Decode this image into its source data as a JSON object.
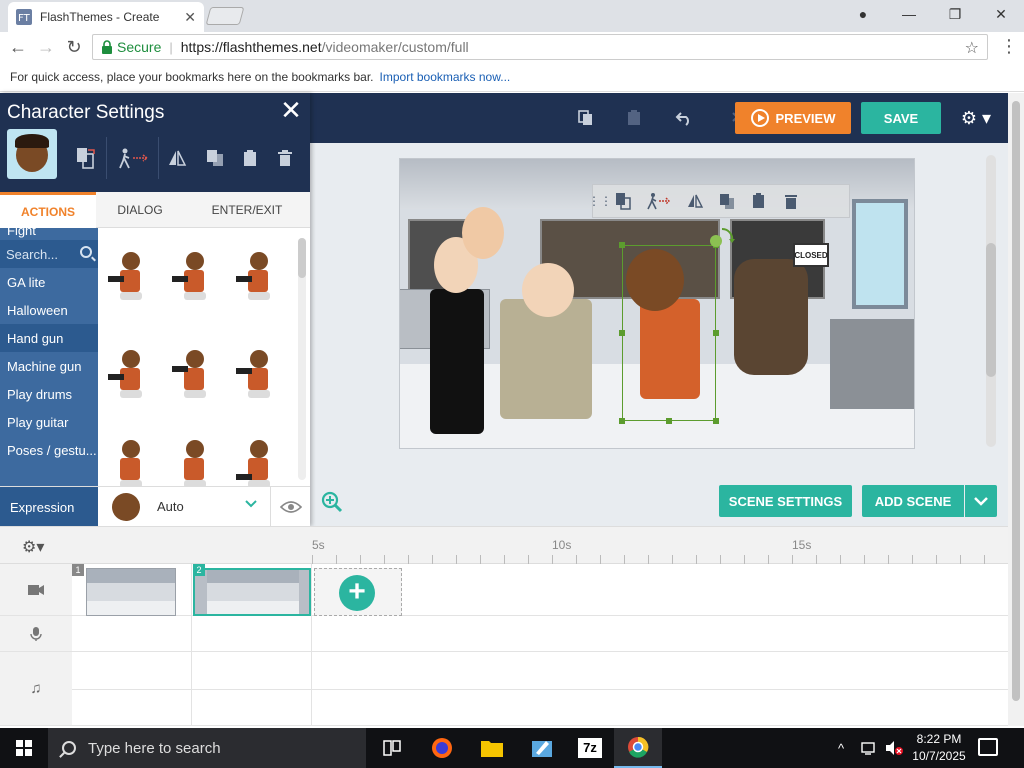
{
  "browser": {
    "tab_title": "FlashThemes - Create",
    "tab_close": "✕",
    "window_controls": {
      "account": "●",
      "minimize": "—",
      "restore": "❐",
      "close": "✕"
    },
    "nav": {
      "back": "←",
      "forward": "→",
      "reload": "↻"
    },
    "address": {
      "secure_label": "Secure",
      "host": "https://flashthemes.net",
      "path": "/videomaker/custom/full"
    },
    "bookmark_icon": "☆",
    "menu_icon": "⋮",
    "bookmarks_bar": {
      "message": "For quick access, place your bookmarks here on the bookmarks bar.",
      "link": "Import bookmarks now..."
    }
  },
  "topbar": {
    "icons": [
      "copy-icon",
      "paste-icon",
      "undo-icon",
      "redo-icon"
    ],
    "preview_label": "PREVIEW",
    "save_label": "SAVE",
    "settings_icon": "⚙ ▾",
    "accent_orange": "#f0822b",
    "accent_teal": "#2bb5a0",
    "nav_bg": "#1f3152"
  },
  "character_panel": {
    "title": "Character Settings",
    "close": "✕",
    "tool_icons": [
      "swap-character-icon",
      "walk-motion-icon",
      "flip-icon",
      "copy-icon",
      "paste-icon",
      "delete-icon"
    ],
    "tabs": [
      {
        "label": "ACTIONS",
        "active": true
      },
      {
        "label": "DIALOG",
        "active": false
      },
      {
        "label": "ENTER/EXIT",
        "active": false
      }
    ],
    "search_placeholder": "Search...",
    "categories": [
      {
        "label": "Fight",
        "active": false
      },
      {
        "label": "GA lite",
        "active": false
      },
      {
        "label": "Halloween",
        "active": false
      },
      {
        "label": "Hand gun",
        "active": true
      },
      {
        "label": "Machine gun",
        "active": false
      },
      {
        "label": "Play drums",
        "active": false
      },
      {
        "label": "Play guitar",
        "active": false
      },
      {
        "label": "Poses / gestu...",
        "active": false
      }
    ],
    "expression": {
      "label": "Expression",
      "value": "Auto",
      "chevron": "⌄",
      "eye": "👁"
    }
  },
  "stage": {
    "closed_sign": "CLOSED",
    "char_toolbar_icons": [
      "drag-handle-icon",
      "swap-character-icon",
      "walk-motion-icon",
      "flip-icon",
      "copy-icon",
      "paste-icon",
      "delete-icon"
    ]
  },
  "scene_controls": {
    "zoom_icon": "⊕",
    "scene_settings_label": "SCENE SETTINGS",
    "add_scene_label": "ADD SCENE",
    "add_scene_dropdown": "⌄"
  },
  "timeline": {
    "gear": "⚙▾",
    "ticks": [
      "5s",
      "10s",
      "15s"
    ],
    "tracks": [
      {
        "name": "video",
        "icon": "▬"
      },
      {
        "name": "voice",
        "icon": "🎙"
      },
      {
        "name": "music",
        "icon": "♫"
      }
    ],
    "scenes": [
      {
        "number": "1",
        "selected": false
      },
      {
        "number": "2",
        "selected": true
      }
    ],
    "add_scene_icon": "+"
  },
  "taskbar": {
    "search_placeholder": "Type here to search",
    "apps": [
      "task-view-icon",
      "firefox-icon",
      "file-explorer-icon",
      "paint-icon",
      "7zip-icon",
      "chrome-icon"
    ],
    "seven_zip_label": "7z",
    "tray_icons": [
      "^",
      "network-icon",
      "volume-muted-icon"
    ],
    "time": "8:22 PM",
    "date": "10/7/2025"
  }
}
